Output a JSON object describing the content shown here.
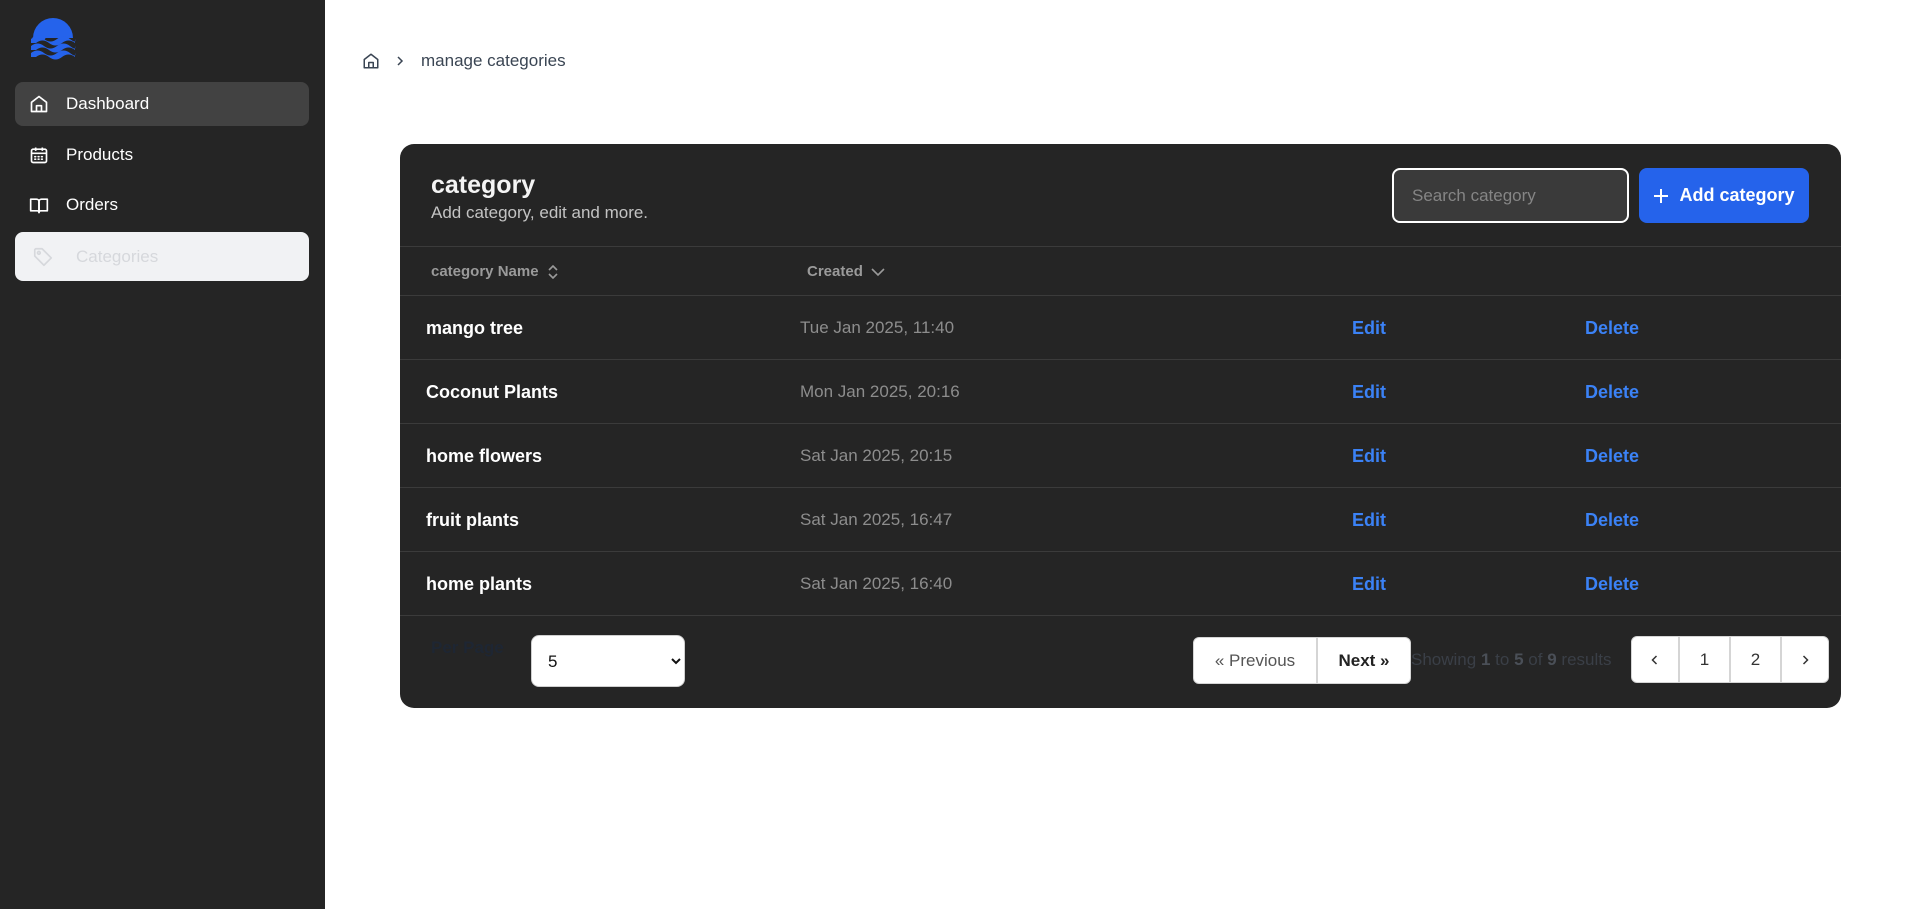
{
  "breadcrumb": {
    "items": [
      "manage categories"
    ]
  },
  "sidebar": {
    "items": [
      {
        "label": "Dashboard",
        "icon": "home-icon"
      },
      {
        "label": "Products",
        "icon": "calendar-icon"
      },
      {
        "label": "Orders",
        "icon": "book-icon"
      },
      {
        "label": "Categories",
        "icon": "tag-icon"
      }
    ]
  },
  "card": {
    "title": "category",
    "subtitle": "Add category, edit and more."
  },
  "search": {
    "placeholder": "Search category"
  },
  "add_button": {
    "label": "Add category"
  },
  "table": {
    "columns": [
      "category Name",
      "Created"
    ],
    "rows": [
      {
        "name": "mango tree",
        "created": "Tue Jan 2025, 11:40",
        "edit": "Edit",
        "delete": "Delete"
      },
      {
        "name": "Coconut Plants",
        "created": "Mon Jan 2025, 20:16",
        "edit": "Edit",
        "delete": "Delete"
      },
      {
        "name": "home flowers",
        "created": "Sat Jan 2025, 20:15",
        "edit": "Edit",
        "delete": "Delete"
      },
      {
        "name": "fruit plants",
        "created": "Sat Jan 2025, 16:47",
        "edit": "Edit",
        "delete": "Delete"
      },
      {
        "name": "home plants",
        "created": "Sat Jan 2025, 16:40",
        "edit": "Edit",
        "delete": "Delete"
      }
    ]
  },
  "pagination": {
    "per_page_label": "Per Page",
    "per_page_value": "5",
    "prev_label": "« Previous",
    "next_label": "Next »",
    "showing_prefix": "Showing",
    "from": "1",
    "to_word": "to",
    "to": "5",
    "of_word": "of",
    "total": "9",
    "results_word": "results",
    "pages": [
      "1",
      "2"
    ]
  },
  "colors": {
    "sidebar_bg": "#252525",
    "card_bg": "#252525",
    "accent": "#2563eb",
    "link": "#3b82f6"
  }
}
